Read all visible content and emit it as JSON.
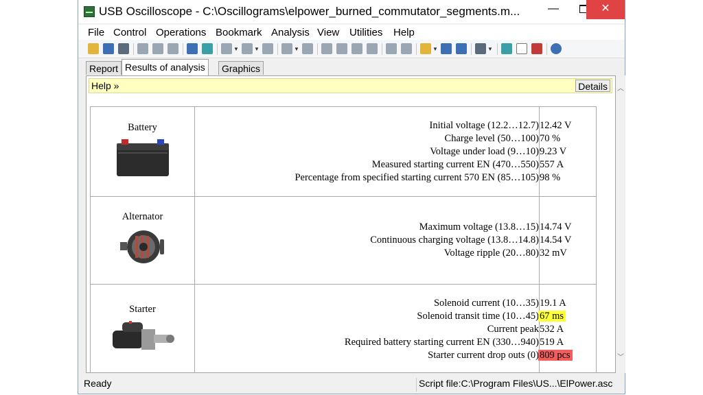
{
  "window": {
    "title": "USB Oscilloscope - C:\\Oscillograms\\elpower_burned_commutator_segments.m...",
    "min_glyph": "—",
    "close_glyph": "✕"
  },
  "menu": [
    "File",
    "Control",
    "Operations",
    "Bookmark",
    "Analysis",
    "View",
    "Utilities",
    "Help"
  ],
  "tabs": [
    "Report",
    "Results of analysis",
    "Graphics"
  ],
  "help": {
    "label": "Help »",
    "details": "Details"
  },
  "components": [
    {
      "name": "Battery",
      "icon": "battery-icon",
      "params": [
        {
          "label": "Initial voltage (12.2…12.7)",
          "value": "12.42 V",
          "highlight": ""
        },
        {
          "label": "Charge level (50…100)",
          "value": "70 %",
          "highlight": ""
        },
        {
          "label": "Voltage under load (9…10)",
          "value": "9.23 V",
          "highlight": ""
        },
        {
          "label": "Measured starting current EN (470…550)",
          "value": "557 A",
          "highlight": ""
        },
        {
          "label": "Percentage from specified starting current 570 EN (85…105)",
          "value": "98 %",
          "highlight": ""
        }
      ]
    },
    {
      "name": "Alternator",
      "icon": "alternator-icon",
      "params": [
        {
          "label": "Maximum voltage (13.8…15)",
          "value": "14.74 V",
          "highlight": ""
        },
        {
          "label": "Continuous charging voltage (13.8…14.8)",
          "value": "14.54 V",
          "highlight": ""
        },
        {
          "label": "Voltage ripple (20…80)",
          "value": "32 mV",
          "highlight": ""
        }
      ]
    },
    {
      "name": "Starter",
      "icon": "starter-icon",
      "params": [
        {
          "label": "Solenoid current (10…35)",
          "value": "19.1 A",
          "highlight": ""
        },
        {
          "label": "Solenoid transit time (10…45)",
          "value": "67 ms",
          "highlight": "#ffff38"
        },
        {
          "label": "Current peak",
          "value": "532 A",
          "highlight": ""
        },
        {
          "label": "Required battery starting current EN (330…940)",
          "value": "519 A",
          "highlight": ""
        },
        {
          "label": "Starter current drop outs (0)",
          "value": "809 pcs",
          "highlight": "#f25e5e"
        }
      ]
    }
  ],
  "status": {
    "left": "Ready",
    "right": "Script file:C:\\Program Files\\US...\\ElPower.asc"
  },
  "colors": {
    "close_button": "#e04343",
    "help_bar": "#ffffc0",
    "warning": "#ffff38",
    "error": "#f25e5e"
  }
}
